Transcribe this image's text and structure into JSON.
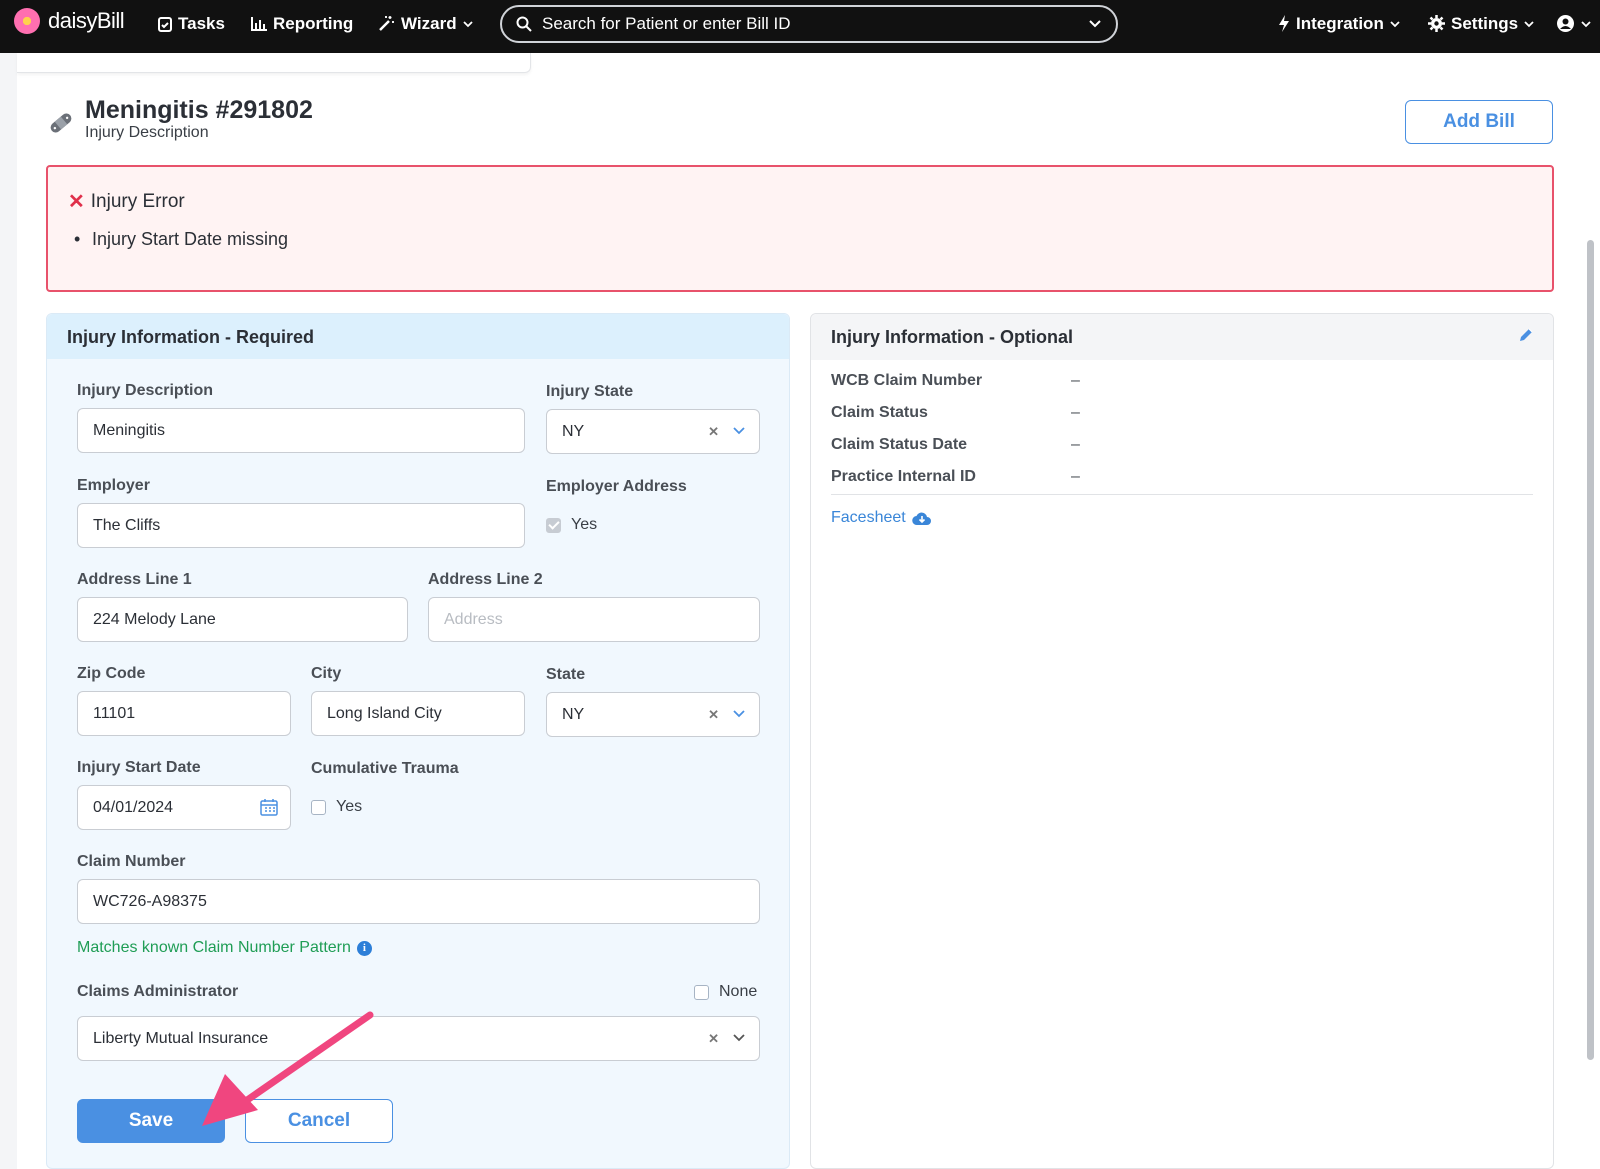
{
  "nav": {
    "logo_text": "daisyBill",
    "tasks": "Tasks",
    "reporting": "Reporting",
    "wizard": "Wizard",
    "search_placeholder": "Search for Patient or enter Bill ID",
    "integration": "Integration",
    "settings": "Settings"
  },
  "header": {
    "title": "Meningitis #291802",
    "subtitle": "Injury Description",
    "add_bill": "Add Bill"
  },
  "error": {
    "title": "Injury Error",
    "items": [
      "Injury Start Date missing"
    ]
  },
  "required": {
    "title": "Injury Information - Required",
    "injury_description": {
      "label": "Injury Description",
      "value": "Meningitis"
    },
    "injury_state": {
      "label": "Injury State",
      "value": "NY"
    },
    "employer": {
      "label": "Employer",
      "value": "The Cliffs"
    },
    "employer_address": {
      "label": "Employer Address",
      "option": "Yes"
    },
    "address1": {
      "label": "Address Line 1",
      "value": "224 Melody Lane"
    },
    "address2": {
      "label": "Address Line 2",
      "placeholder": "Address"
    },
    "zip": {
      "label": "Zip Code",
      "value": "11101"
    },
    "city": {
      "label": "City",
      "value": "Long Island City"
    },
    "state": {
      "label": "State",
      "value": "NY"
    },
    "start_date": {
      "label": "Injury Start Date",
      "value": "04/01/2024"
    },
    "cumulative": {
      "label": "Cumulative Trauma",
      "option": "Yes"
    },
    "claim_number": {
      "label": "Claim Number",
      "value": "WC726-A98375"
    },
    "claim_hint": "Matches known Claim Number Pattern",
    "claims_admin": {
      "label": "Claims Administrator",
      "none_label": "None",
      "value": "Liberty Mutual Insurance"
    },
    "save": "Save",
    "cancel": "Cancel"
  },
  "optional": {
    "title": "Injury Information - Optional",
    "rows": [
      {
        "label": "WCB Claim Number",
        "value": "–"
      },
      {
        "label": "Claim Status",
        "value": "–"
      },
      {
        "label": "Claim Status Date",
        "value": "–"
      },
      {
        "label": "Practice Internal ID",
        "value": "–"
      }
    ],
    "facesheet": "Facesheet"
  },
  "colors": {
    "accent": "#4a90e2",
    "error": "#e8526b",
    "success": "#1f9d55",
    "annotation_arrow": "#f0467f"
  }
}
